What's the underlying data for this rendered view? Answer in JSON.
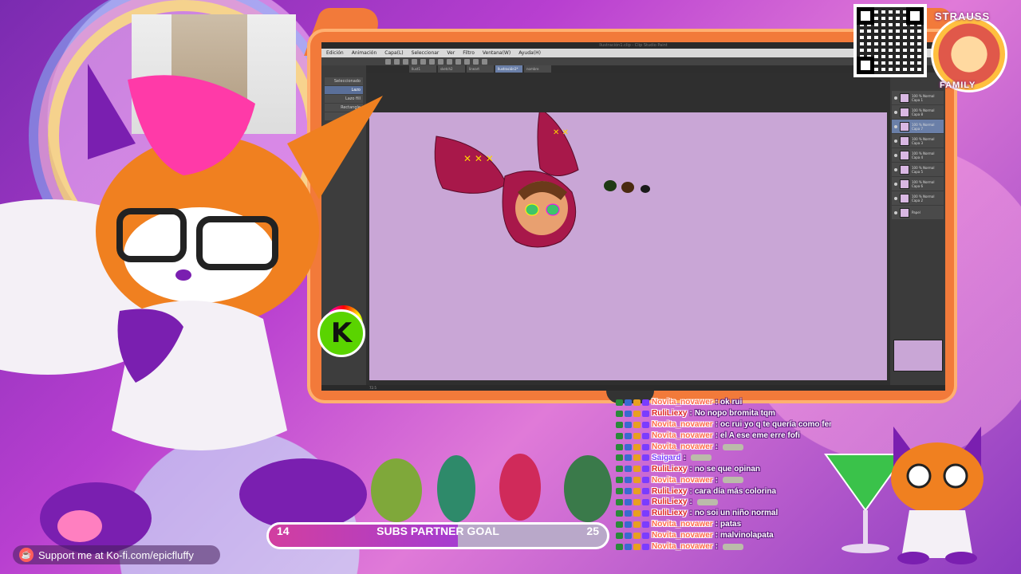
{
  "app": {
    "title": "Ilustración1.clip - Clip Studio Paint",
    "menu": [
      "Edición",
      "Animación",
      "Capa(L)",
      "Seleccionar",
      "Ver",
      "Filtro",
      "Ventana(W)",
      "Ayuda(H)"
    ],
    "tabs": [
      "Ilust1",
      "sketch2",
      "lineart",
      "Ilustración1*",
      "nombre"
    ],
    "active_tab_index": 3,
    "tools": [
      "Seleccionado",
      "Lazo",
      "Lazo fill",
      "Rectangle",
      "Elipse"
    ],
    "selected_tool_index": 1,
    "layers": [
      {
        "mode": "100 % Normal",
        "name": "Capa 1"
      },
      {
        "mode": "100 % Normal",
        "name": "Capa 8"
      },
      {
        "mode": "100 % Normal",
        "name": "Capa 7"
      },
      {
        "mode": "100 % Normal",
        "name": "Capa 3"
      },
      {
        "mode": "100 % Normal",
        "name": "Capa 4"
      },
      {
        "mode": "100 % Normal",
        "name": "Capa 5"
      },
      {
        "mode": "100 % Normal",
        "name": "Capa 6"
      },
      {
        "mode": "100 % Normal",
        "name": "Capa 2"
      },
      {
        "mode": "",
        "name": "Papel"
      }
    ],
    "selected_layer_index": 2,
    "zoom": "72.5",
    "canvas_color": "#c9a6d6"
  },
  "badge": {
    "top": "STRAUSS",
    "bottom": "FAMILY"
  },
  "goal": {
    "start": "14",
    "label": "SUBS PARTNER GOAL",
    "end": "25",
    "current": 14,
    "target": 25
  },
  "kofi": {
    "text": "Support me at Ko-fi.com/epicfluffy"
  },
  "chat": [
    {
      "user": "Novita_novawer",
      "color": "#ff6b4a",
      "msg": "ok rui"
    },
    {
      "user": "RuliLiexy",
      "color": "#d22",
      "msg": "No nopo bromita tqm"
    },
    {
      "user": "Novita_novawer",
      "color": "#ff6b4a",
      "msg": "oc rui yo q te quería como femboy"
    },
    {
      "user": "Novita_novawer",
      "color": "#ff6b4a",
      "msg": "el A ese eme erre fofi"
    },
    {
      "user": "Novita_novawer",
      "color": "#ff6b4a",
      "msg": ""
    },
    {
      "user": "Saigard",
      "color": "#7a3cff",
      "msg": ""
    },
    {
      "user": "RuliLiexy",
      "color": "#d22",
      "msg": "no se que opinan"
    },
    {
      "user": "Novita_novawer",
      "color": "#ff6b4a",
      "msg": ""
    },
    {
      "user": "RuliLiexy",
      "color": "#d22",
      "msg": "cara día más colorina"
    },
    {
      "user": "RuliLiexy",
      "color": "#d22",
      "msg": ""
    },
    {
      "user": "RuliLiexy",
      "color": "#d22",
      "msg": "no soi un niño normal"
    },
    {
      "user": "Novita_novawer",
      "color": "#ff6b4a",
      "msg": "patas"
    },
    {
      "user": "Novita_novawer",
      "color": "#ff6b4a",
      "msg": "malvinolapata"
    },
    {
      "user": "Novita_novawer",
      "color": "#ff6b4a",
      "msg": ""
    }
  ],
  "colors": {
    "accent": "#f27a3a",
    "purple": "#7a2bb0",
    "pink": "#e0509b",
    "k_green": "#5ad400"
  },
  "icons": [
    "qr-code-icon",
    "kofi-cup-icon",
    "k-logo-icon",
    "color-wheel-icon",
    "eye-icon"
  ]
}
